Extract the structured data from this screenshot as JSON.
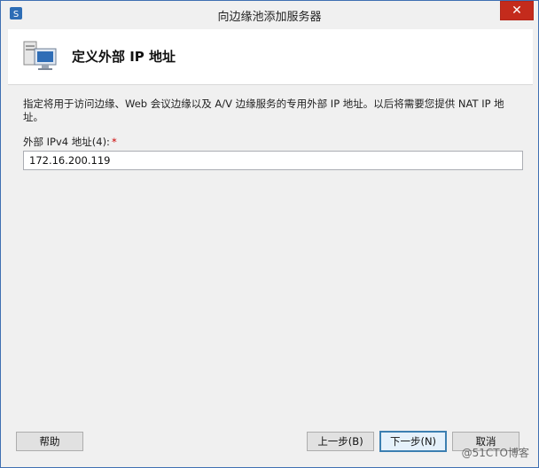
{
  "window": {
    "title": "向边缘池添加服务器",
    "close_glyph": "✕"
  },
  "header": {
    "title": "定义外部 IP 地址",
    "icon": "server-network-icon"
  },
  "content": {
    "description": "指定将用于访问边缘、Web 会议边缘以及 A/V 边缘服务的专用外部 IP 地址。以后将需要您提供 NAT IP 地址。",
    "field_label": "外部 IPv4 地址(4):",
    "required_mark": "*",
    "ip_value": "172.16.200.119"
  },
  "buttons": {
    "help": "帮助",
    "prev": "上一步(B)",
    "next": "下一步(N)",
    "cancel": "取消"
  },
  "watermark": "@51CTO博客",
  "colors": {
    "accent_border": "#3f6fb2",
    "close_button": "#c42b1c",
    "default_button_border": "#3c7fb1",
    "required": "#cc0000"
  }
}
